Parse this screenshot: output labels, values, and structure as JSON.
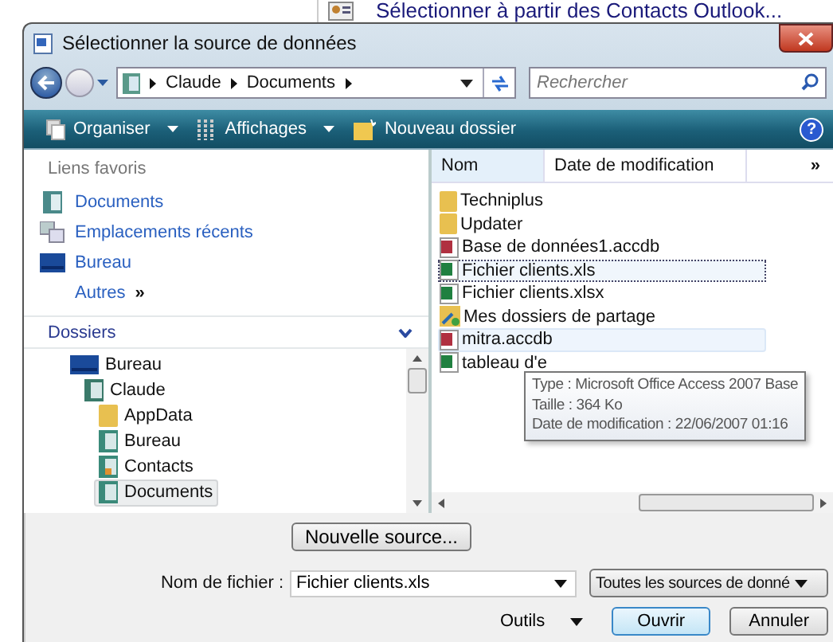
{
  "background_menu_item": {
    "label": "Sélectionner à partir des Contacts Outlook..."
  },
  "window": {
    "title": "Sélectionner la source de données"
  },
  "address_bar": {
    "crumbs": [
      "Claude",
      "Documents"
    ]
  },
  "search": {
    "placeholder": "Rechercher"
  },
  "help_button": "?",
  "toolbar": [
    {
      "label": "Organiser",
      "kind": "organize",
      "dropdown": true
    },
    {
      "label": "Affichages",
      "kind": "views",
      "dropdown": true
    },
    {
      "label": "Nouveau dossier",
      "kind": "newfolder",
      "dropdown": false
    }
  ],
  "favorites": {
    "title": "Liens favoris",
    "items": [
      {
        "label": "Documents",
        "kind": "documents"
      },
      {
        "label": "Emplacements récents",
        "kind": "recent"
      },
      {
        "label": "Bureau",
        "kind": "desktop"
      },
      {
        "label": "Autres",
        "kind": "more",
        "chevron": "»"
      }
    ]
  },
  "folders": {
    "title": "Dossiers",
    "tree": [
      {
        "label": "Bureau",
        "kind": "desktop",
        "selected": false,
        "children": [
          {
            "label": "Claude",
            "kind": "user",
            "selected": false,
            "children": [
              {
                "label": "AppData",
                "kind": "folder",
                "selected": false
              },
              {
                "label": "Bureau",
                "kind": "library",
                "selected": false
              },
              {
                "label": "Contacts",
                "kind": "contacts",
                "selected": false
              },
              {
                "label": "Documents",
                "kind": "library",
                "selected": true
              }
            ]
          }
        ]
      }
    ]
  },
  "file_list": {
    "columns": [
      "Nom",
      "Date de modification"
    ],
    "more_columns": "»",
    "files": [
      {
        "name": "Techniplus",
        "kind": "folder",
        "selected": false,
        "hovered": false
      },
      {
        "name": "Updater",
        "kind": "folder",
        "selected": false,
        "hovered": false
      },
      {
        "name": "Base de données1.accdb",
        "kind": "access",
        "selected": false,
        "hovered": false
      },
      {
        "name": "Fichier clients.xls",
        "kind": "excel",
        "selected": true,
        "hovered": false
      },
      {
        "name": "Fichier clients.xlsx",
        "kind": "excel",
        "selected": false,
        "hovered": false
      },
      {
        "name": "Mes dossiers de partage",
        "kind": "shared",
        "selected": false,
        "hovered": false
      },
      {
        "name": "mitra.accdb",
        "kind": "access",
        "selected": false,
        "hovered": true
      },
      {
        "name": "tableau d'e",
        "kind": "excel",
        "selected": false,
        "hovered": false
      }
    ]
  },
  "tooltip": {
    "lines": [
      "Type : Microsoft Office Access 2007 Base",
      "Taille : 364 Ko",
      "Date de modification : 22/06/2007 01:16"
    ]
  },
  "new_source_button": "Nouvelle source...",
  "filename": {
    "label": "Nom de fichier :",
    "value": "Fichier clients.xls"
  },
  "file_type": {
    "value": "Toutes les sources de donné"
  },
  "tools": {
    "label": "Outils"
  },
  "buttons": [
    {
      "label": "Ouvrir",
      "kind": "default"
    },
    {
      "label": "Annuler",
      "kind": "normal"
    }
  ]
}
